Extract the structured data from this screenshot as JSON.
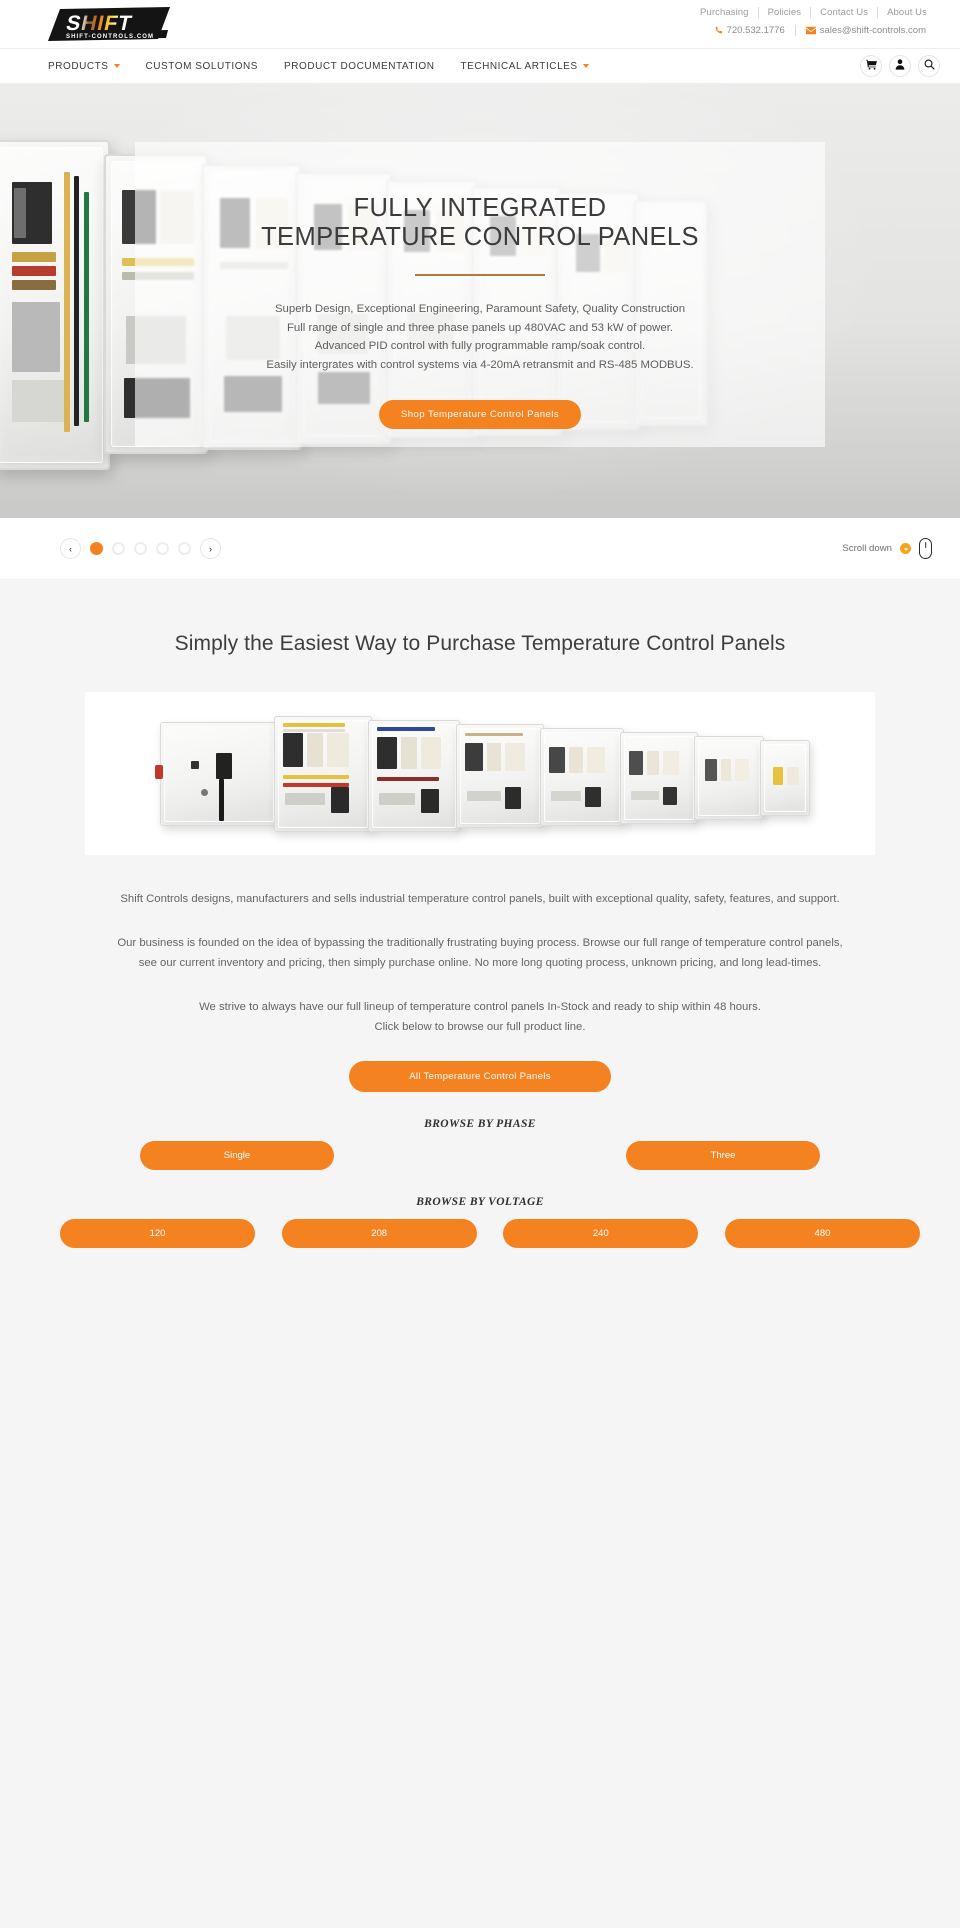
{
  "brand": {
    "logo_text": "SHIFT",
    "logo_sub": "SHIFT-CONTROLS.COM"
  },
  "topbar": {
    "links": [
      {
        "label": "Purchasing"
      },
      {
        "label": "Policies"
      },
      {
        "label": "Contact Us"
      },
      {
        "label": "About Us"
      }
    ],
    "phone": "720.532.1776",
    "phone_icon": "phone-icon",
    "email": "sales@shift-controls.com",
    "email_icon": "envelope-icon"
  },
  "nav": {
    "items": [
      {
        "label": "PRODUCTS",
        "caret": true
      },
      {
        "label": "CUSTOM SOLUTIONS",
        "caret": false
      },
      {
        "label": "PRODUCT DOCUMENTATION",
        "caret": false
      },
      {
        "label": "TECHNICAL ARTICLES",
        "caret": true
      }
    ],
    "icons": [
      {
        "name": "cart-icon"
      },
      {
        "name": "user-icon"
      },
      {
        "name": "search-icon"
      }
    ]
  },
  "hero": {
    "title_line1": "FULLY INTEGRATED",
    "title_line2": "TEMPERATURE CONTROL PANELS",
    "sub_lines": [
      "Superb Design, Exceptional Engineering, Paramount Safety, Quality Construction",
      "Full range of single and three phase panels up 480VAC and 53 kW of power.",
      "Advanced PID control with fully programmable ramp/soak control.",
      "Easily intergrates with control systems via 4-20mA retransmit and RS-485 MODBUS."
    ],
    "cta_label": "Shop Temperature Control Panels",
    "accent_color": "#f58220",
    "rule_color": "#b07a3a"
  },
  "carousel": {
    "prev_label": "‹",
    "next_label": "›",
    "slide_count": 5,
    "active_slide": 1,
    "scroll_label": "Scroll down",
    "scroll_icon": "arrow-down-circle-icon",
    "mouse_icon": "mouse-icon"
  },
  "main": {
    "section_title": "Simply the Easiest Way to Purchase Temperature Control Panels",
    "product_image_alt": "temperature-control-panel-lineup",
    "paragraphs": [
      "Shift Controls designs, manufacturers and sells industrial temperature control panels, built with exceptional quality, safety, features, and support.",
      "Our business is founded on the idea of bypassing the traditionally frustrating buying process. Browse our full range of temperature control panels,",
      "see our current inventory and pricing, then simply purchase online. No more long quoting process, unknown pricing, and long lead-times.",
      "We strive to always have our full lineup of temperature control panels In-Stock and ready to ship within 48 hours.",
      "Click below to browse our full product line."
    ],
    "all_panels_label": "All Temperature Control Panels",
    "browse_phase_label": "BROWSE BY PHASE",
    "phases": [
      {
        "label": "Single"
      },
      {
        "label": "Three"
      }
    ],
    "browse_voltage_label": "BROWSE BY VOLTAGE",
    "voltages": [
      {
        "label": "120"
      },
      {
        "label": "208"
      },
      {
        "label": "240"
      },
      {
        "label": "480"
      }
    ]
  }
}
